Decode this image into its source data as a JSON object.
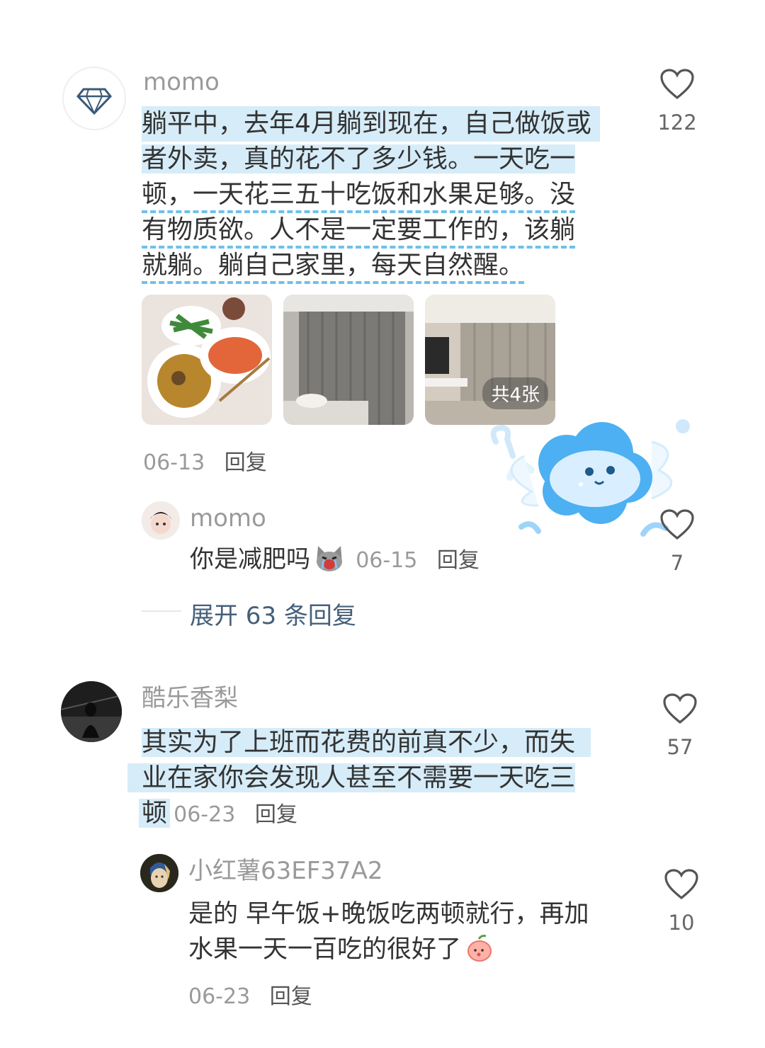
{
  "comments": [
    {
      "user": "momo",
      "lines": [
        "躺平中，去年4月躺到现在，自己做饭或",
        "者外卖，真的花不了多少钱。一天吃一",
        "顿，一天花三五十吃饭和水果足够。没",
        "有物质欲。人不是一定要工作的，该躺",
        "就躺。躺自己家里，每天自然醒。"
      ],
      "photo_count_label": "共4张",
      "date": "06-13",
      "reply_label": "回复",
      "likes": "122",
      "sub_reply": {
        "user": "momo",
        "text": "你是减肥吗",
        "date": "06-15",
        "reply_label": "回复",
        "likes": "7"
      },
      "expand_label": "展开 63 条回复"
    },
    {
      "user": "酷乐香梨",
      "lines": [
        "其实为了上班而花费的前真不少，而失",
        "业在家你会发现人甚至不需要一天吃三",
        "顿"
      ],
      "date": "06-23",
      "reply_label": "回复",
      "likes": "57",
      "sub_reply": {
        "user": "小红薯63EF37A2",
        "lines": [
          "是的 早午饭+晚饭吃两顿就行，再加",
          "水果一天一百吃的很好了"
        ],
        "date": "06-23",
        "reply_label": "回复",
        "likes": "10"
      }
    }
  ],
  "icons": {
    "avatar1": "diamond-icon",
    "like": "heart-outline-icon",
    "sticker": "cloud-sticker-icon",
    "emoji_cat": "crying-cat-emoji",
    "emoji_peach": "peach-emoji"
  },
  "colors": {
    "highlight": "#d6ecf8",
    "dash": "#6fc0ec",
    "name": "#9a9a9a",
    "expand": "#45607a"
  }
}
